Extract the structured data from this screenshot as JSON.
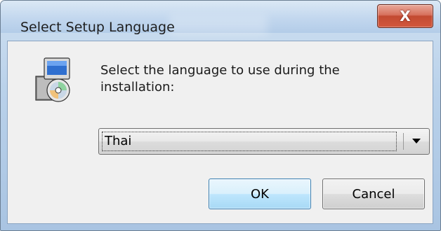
{
  "window": {
    "title": "Select Setup Language",
    "close_glyph": "X"
  },
  "dialog": {
    "prompt": "Select the language to use during the installation:",
    "icon": "setup-computer-disc-icon"
  },
  "language_select": {
    "selected": "Thai"
  },
  "buttons": {
    "ok_label": "OK",
    "cancel_label": "Cancel"
  },
  "colors": {
    "title_bar": "#c2d7ee",
    "close_button": "#c24a31",
    "client_bg": "#f0f0f0",
    "default_button": "#bee6fd"
  }
}
